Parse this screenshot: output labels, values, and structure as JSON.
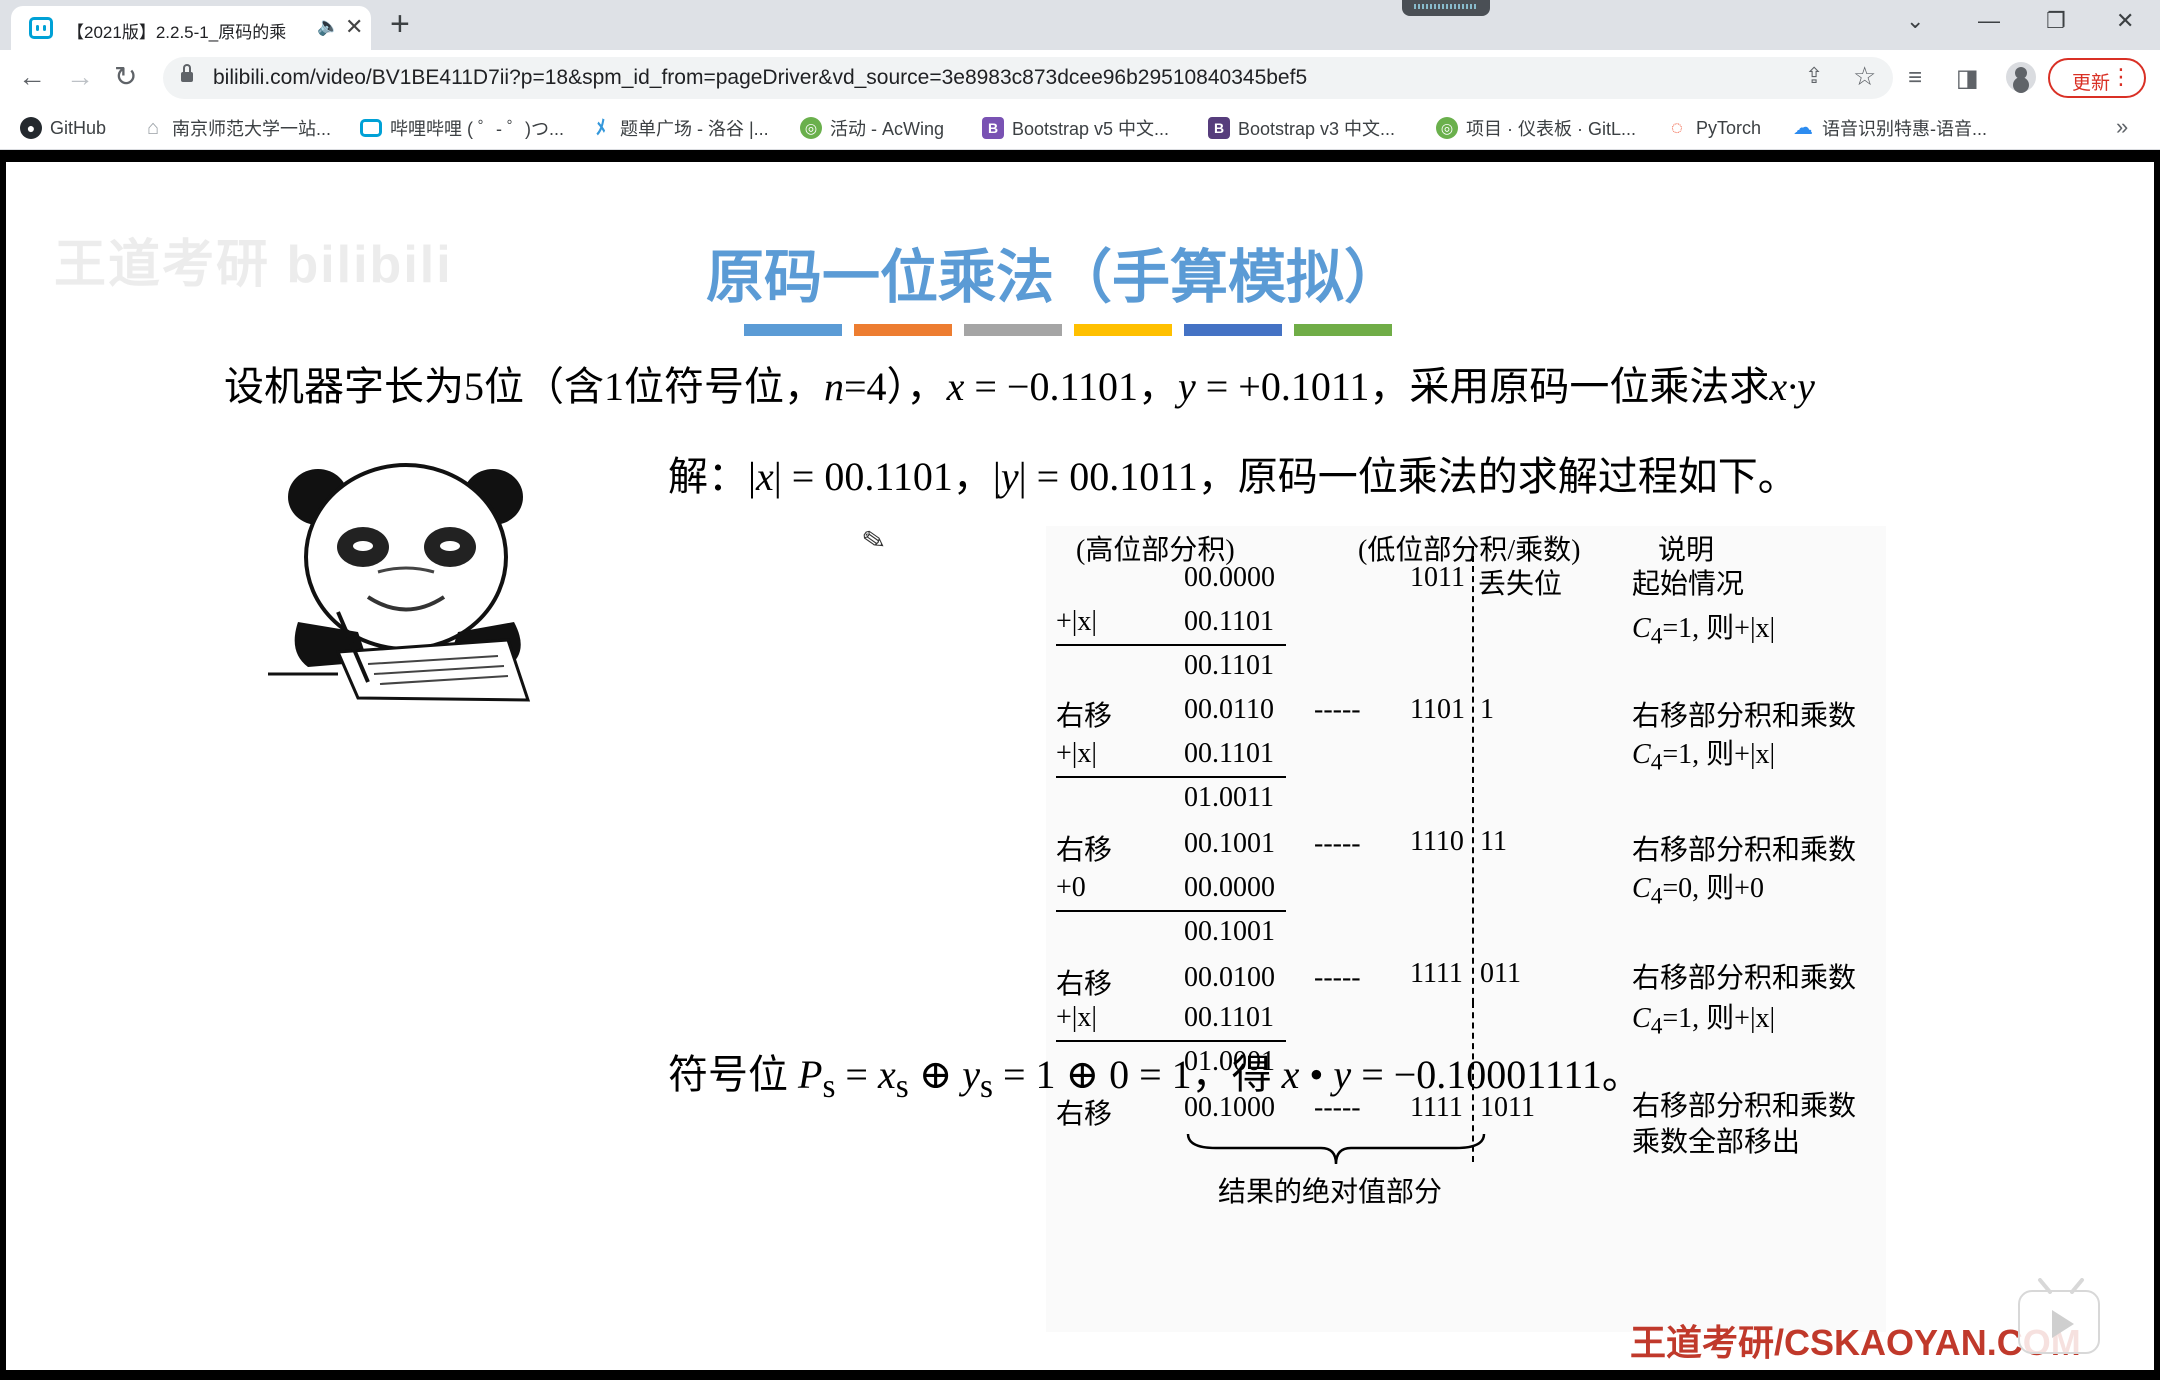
{
  "browser": {
    "tab_title": "【2021版】2.2.5-1_原码的乘",
    "new_tab": "+",
    "url": "bilibili.com/video/BV1BE411D7ii?p=18&spm_id_from=pageDriver&vd_source=3e8983c873dcee96b29510840345bef5",
    "update_label": "更新",
    "bookmarks": [
      {
        "label": "GitHub",
        "icon": "github-icon",
        "color": "#24292e"
      },
      {
        "label": "南京师范大学一站...",
        "icon": "home-icon",
        "color": "#9aa0a6"
      },
      {
        "label": "哔哩哔哩 ( ゜- ゜)つ...",
        "icon": "bilibili-icon",
        "color": "#00a1d6"
      },
      {
        "label": "题单广场 - 洛谷 |...",
        "icon": "luogu-icon",
        "color": "#3498db"
      },
      {
        "label": "活动 - AcWing",
        "icon": "acwing-icon",
        "color": "#6ab04c"
      },
      {
        "label": "Bootstrap v5 中文...",
        "icon": "bootstrap-icon",
        "color": "#7952b3"
      },
      {
        "label": "Bootstrap v3 中文...",
        "icon": "bootstrap-icon",
        "color": "#563d7c"
      },
      {
        "label": "项目 · 仪表板 · GitL...",
        "icon": "gitlab-icon",
        "color": "#6ab04c"
      },
      {
        "label": "PyTorch",
        "icon": "pytorch-icon",
        "color": "#ee4c2c"
      },
      {
        "label": "语音识别特惠-语音...",
        "icon": "cloud-icon",
        "color": "#2d8cf0"
      }
    ]
  },
  "slide": {
    "watermark": "王道考研 bilibili",
    "title": "原码一位乘法（手算模拟）",
    "stripe_colors": [
      "#5b9bd5",
      "#ed7d31",
      "#a5a5a5",
      "#ffc000",
      "#4472c4",
      "#70ad47"
    ],
    "problem": {
      "p1": "设机器字长为5位（含1位符号位，",
      "n": "n",
      "p2": "=4），",
      "x": "x",
      "p3": " = −0.1101，",
      "y": "y",
      "p4": " = +0.1011，采用原码一位乘法求",
      "xy": "x·y"
    },
    "solution": {
      "p1": "解：|",
      "x": "x",
      "p2": "| = 00.1101，|",
      "y": "y",
      "p3": "| = 00.1011，原码一位乘法的求解过程如下。"
    },
    "calc": {
      "hdr_high": "(高位部分积)",
      "hdr_low": "(低位部分积/乘数)",
      "hdr_note": "说明",
      "init_high": "00.0000",
      "init_low": "1011",
      "lost": "丢失位",
      "note_init": "起始情况",
      "add_x": "+|x|",
      "val_x": "00.1101",
      "note_c1": "C",
      "sub4": "4",
      "note_c1_rest": "=1, 则+|x|",
      "note_c0_rest": "=0, 则+0",
      "sum1": "00.1101",
      "shift": "右移",
      "r1_high": "00.0110",
      "dash": "-----",
      "r1_low_a": "1101",
      "r1_low_b": "1",
      "note_shift": "右移部分积和乘数",
      "sum2": "01.0011",
      "r2_high": "00.1001",
      "r2_low_a": "1110",
      "r2_low_b": "11",
      "add_zero": "+0",
      "zero": "00.0000",
      "sum3": "00.1001",
      "r3_high": "00.0100",
      "r3_low_a": "1111",
      "r3_low_b": "011",
      "sum4": "01.0001",
      "r4_high": "00.1000",
      "r4_low_a": "1111",
      "r4_low_b": "1011",
      "note_all_out": "乘数全部移出",
      "brace_label": "结果的绝对值部分"
    },
    "sign": {
      "p1": "符号位 ",
      "P": "P",
      "s": "s",
      "p2": " = ",
      "x": "x",
      "p3": " ⊕ ",
      "y": "y",
      "p4": " = 1 ⊕ 0 = 1，得 ",
      "xy1": "x",
      "dot": " • ",
      "xy2": "y",
      "p5": " = −0.10001111。"
    },
    "brand": "王道考研/CSKAOYAN.COM"
  }
}
